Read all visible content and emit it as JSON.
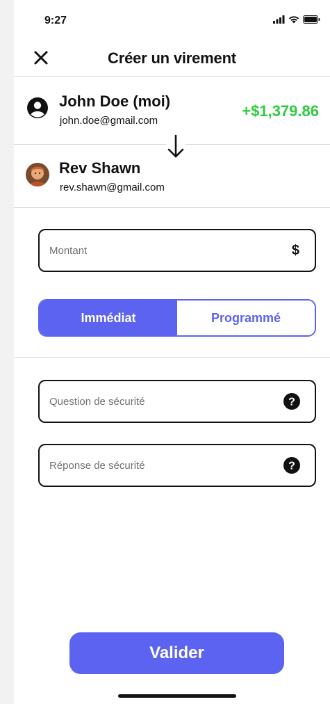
{
  "status_bar": {
    "time": "9:27",
    "icons": [
      "signal-icon",
      "wifi-icon",
      "battery-icon"
    ]
  },
  "header": {
    "title": "Créer un virement",
    "close_icon": "close-icon"
  },
  "sender": {
    "name": "John Doe (moi)",
    "email": "john.doe@gmail.com",
    "balance": "+$1,379.86",
    "balance_color": "#2ecc40",
    "icon": "user-circle-icon"
  },
  "transfer_direction_icon": "arrow-down-icon",
  "recipient": {
    "name": "Rev Shawn",
    "email": "rev.shawn@gmail.com",
    "avatar": "avatar"
  },
  "amount_field": {
    "placeholder": "Montant",
    "value": "",
    "currency_symbol": "$"
  },
  "timing_toggle": {
    "options": [
      "Immédiat",
      "Programmé"
    ],
    "selected": "Immédiat"
  },
  "security_question_field": {
    "placeholder": "Question de sécurité",
    "value": "",
    "icon": "help-icon"
  },
  "security_answer_field": {
    "placeholder": "Réponse de sécurité",
    "value": "",
    "icon": "help-icon"
  },
  "submit": {
    "label": "Valider"
  },
  "colors": {
    "accent": "#5b63f0",
    "positive": "#2ecc40",
    "text": "#111111",
    "divider": "#d6d6d6"
  }
}
